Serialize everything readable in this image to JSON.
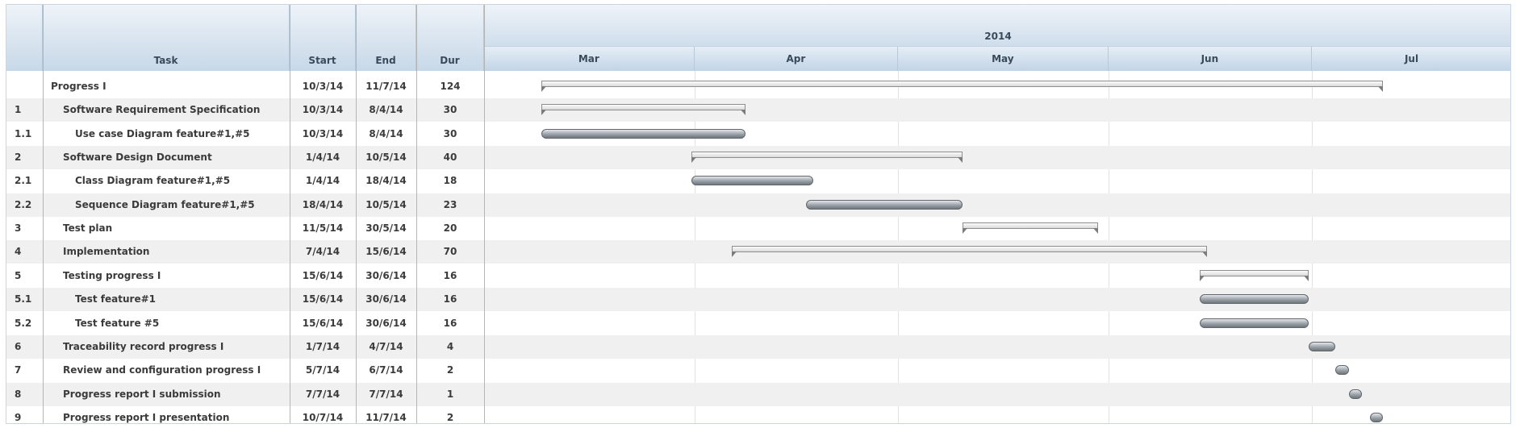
{
  "columns": {
    "num": "",
    "task": "Task",
    "start": "Start",
    "end": "End",
    "dur": "Dur"
  },
  "timeline": {
    "year": "2014",
    "months": [
      "Mar",
      "Apr",
      "May",
      "Jun",
      "Jul"
    ]
  },
  "rows": [
    {
      "num": "",
      "task": "Progress I",
      "start": "10/3/14",
      "end": "11/7/14",
      "dur": "124",
      "type": "summary",
      "level": 0,
      "s": "2014-03-10",
      "e": "2014-07-11"
    },
    {
      "num": "1",
      "task": "Software Requirement Specification",
      "start": "10/3/14",
      "end": "8/4/14",
      "dur": "30",
      "type": "summary",
      "level": 1,
      "s": "2014-03-10",
      "e": "2014-04-08"
    },
    {
      "num": "1.1",
      "task": "Use case Diagram feature#1,#5",
      "start": "10/3/14",
      "end": "8/4/14",
      "dur": "30",
      "type": "task",
      "level": 2,
      "s": "2014-03-10",
      "e": "2014-04-08"
    },
    {
      "num": "2",
      "task": "Software Design Document",
      "start": "1/4/14",
      "end": "10/5/14",
      "dur": "40",
      "type": "summary",
      "level": 1,
      "s": "2014-04-01",
      "e": "2014-05-10"
    },
    {
      "num": "2.1",
      "task": "Class Diagram feature#1,#5",
      "start": "1/4/14",
      "end": "18/4/14",
      "dur": "18",
      "type": "task",
      "level": 2,
      "s": "2014-04-01",
      "e": "2014-04-18"
    },
    {
      "num": "2.2",
      "task": "Sequence Diagram feature#1,#5",
      "start": "18/4/14",
      "end": "10/5/14",
      "dur": "23",
      "type": "task",
      "level": 2,
      "s": "2014-04-18",
      "e": "2014-05-10"
    },
    {
      "num": "3",
      "task": "Test plan",
      "start": "11/5/14",
      "end": "30/5/14",
      "dur": "20",
      "type": "summary",
      "level": 1,
      "s": "2014-05-11",
      "e": "2014-05-30"
    },
    {
      "num": "4",
      "task": "Implementation",
      "start": "7/4/14",
      "end": "15/6/14",
      "dur": "70",
      "type": "summary",
      "level": 1,
      "s": "2014-04-07",
      "e": "2014-06-15"
    },
    {
      "num": "5",
      "task": "Testing progress I",
      "start": "15/6/14",
      "end": "30/6/14",
      "dur": "16",
      "type": "summary",
      "level": 1,
      "s": "2014-06-15",
      "e": "2014-06-30"
    },
    {
      "num": "5.1",
      "task": "Test feature#1",
      "start": "15/6/14",
      "end": "30/6/14",
      "dur": "16",
      "type": "task",
      "level": 2,
      "s": "2014-06-15",
      "e": "2014-06-30"
    },
    {
      "num": "5.2",
      "task": "Test feature #5",
      "start": "15/6/14",
      "end": "30/6/14",
      "dur": "16",
      "type": "task",
      "level": 2,
      "s": "2014-06-15",
      "e": "2014-06-30"
    },
    {
      "num": "6",
      "task": "Traceability record progress I",
      "start": "1/7/14",
      "end": "4/7/14",
      "dur": "4",
      "type": "task",
      "level": 1,
      "s": "2014-07-01",
      "e": "2014-07-04"
    },
    {
      "num": "7",
      "task": "Review and configuration progress I",
      "start": "5/7/14",
      "end": "6/7/14",
      "dur": "2",
      "type": "task",
      "level": 1,
      "s": "2014-07-05",
      "e": "2014-07-06"
    },
    {
      "num": "8",
      "task": "Progress report I submission",
      "start": "7/7/14",
      "end": "7/7/14",
      "dur": "1",
      "type": "task",
      "level": 1,
      "s": "2014-07-07",
      "e": "2014-07-07"
    },
    {
      "num": "9",
      "task": "Progress report I presentation",
      "start": "10/7/14",
      "end": "11/7/14",
      "dur": "2",
      "type": "task",
      "level": 1,
      "s": "2014-07-10",
      "e": "2014-07-11"
    }
  ]
}
